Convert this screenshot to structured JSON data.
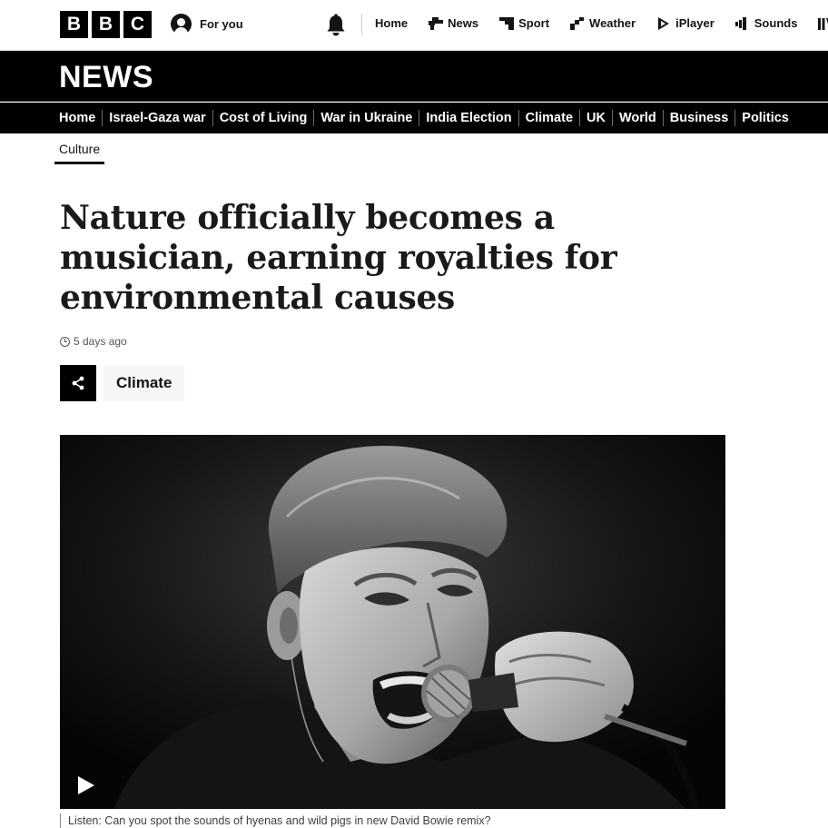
{
  "logo": {
    "letters": [
      "B",
      "B",
      "C"
    ]
  },
  "header": {
    "for_you_label": "For you",
    "nav": [
      {
        "label": "Home",
        "icon": ""
      },
      {
        "label": "News",
        "icon": "news-icon"
      },
      {
        "label": "Sport",
        "icon": "sport-icon"
      },
      {
        "label": "Weather",
        "icon": "weather-icon"
      },
      {
        "label": "iPlayer",
        "icon": "iplayer-icon"
      },
      {
        "label": "Sounds",
        "icon": "sounds-icon"
      }
    ]
  },
  "banner": {
    "wordmark": "NEWS"
  },
  "sections": [
    "Home",
    "Israel-Gaza war",
    "Cost of Living",
    "War in Ukraine",
    "India Election",
    "Climate",
    "UK",
    "World",
    "Business",
    "Politics"
  ],
  "breadcrumb": "Culture",
  "article": {
    "headline": "Nature officially becomes a musician, earning royalties for environmental causes",
    "timestamp": "5 days ago",
    "topic_tag": "Climate",
    "caption": "Listen: Can you spot the sounds of hyenas and wild pigs in new David Bowie remix?"
  },
  "colors": {
    "brand_black": "#000000",
    "text": "#141414",
    "muted": "#545658",
    "tag_bg": "#f6f6f6"
  }
}
